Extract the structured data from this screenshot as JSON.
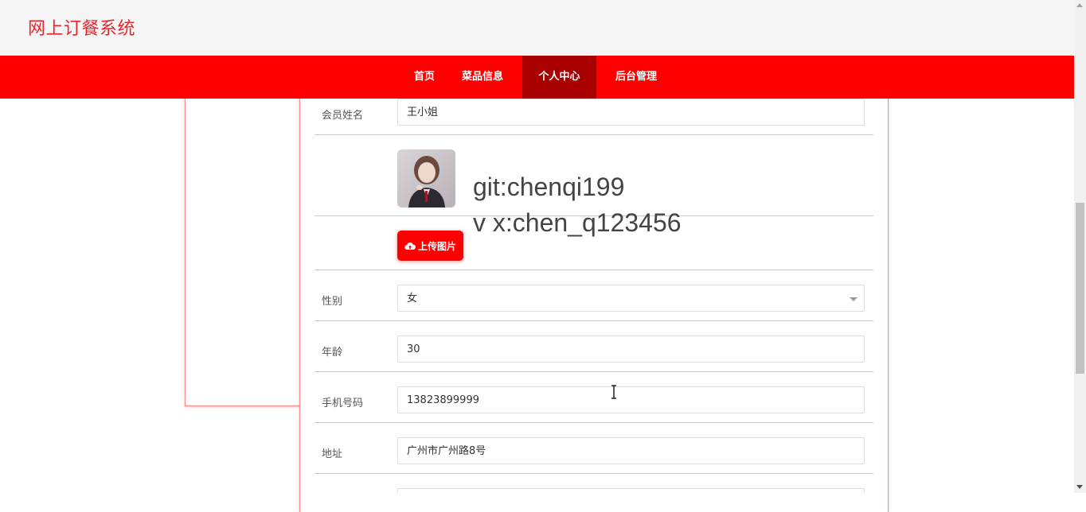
{
  "app": {
    "title": "网上订餐系统"
  },
  "nav": {
    "items": [
      {
        "label": "首页"
      },
      {
        "label": "菜品信息"
      },
      {
        "label": "个人中心"
      },
      {
        "label": "后台管理"
      }
    ],
    "active_index": 2
  },
  "form": {
    "name": {
      "label": "会员姓名",
      "value": "王小姐"
    },
    "avatar": {
      "upload_label": "上传图片",
      "icon": "cloud-upload-icon"
    },
    "watermark": {
      "line1": "git:chenqi199",
      "line2": "v x:chen_q123456"
    },
    "gender": {
      "label": "性别",
      "value": "女"
    },
    "age": {
      "label": "年龄",
      "value": "30"
    },
    "phone": {
      "label": "手机号码",
      "value": "13823899999"
    },
    "address": {
      "label": "地址",
      "value": "广州市广州路8号"
    }
  },
  "colors": {
    "brand": "#ff0000",
    "nav_active": "#a80000",
    "title": "#e8262c",
    "divider": "#ffb3b3"
  }
}
